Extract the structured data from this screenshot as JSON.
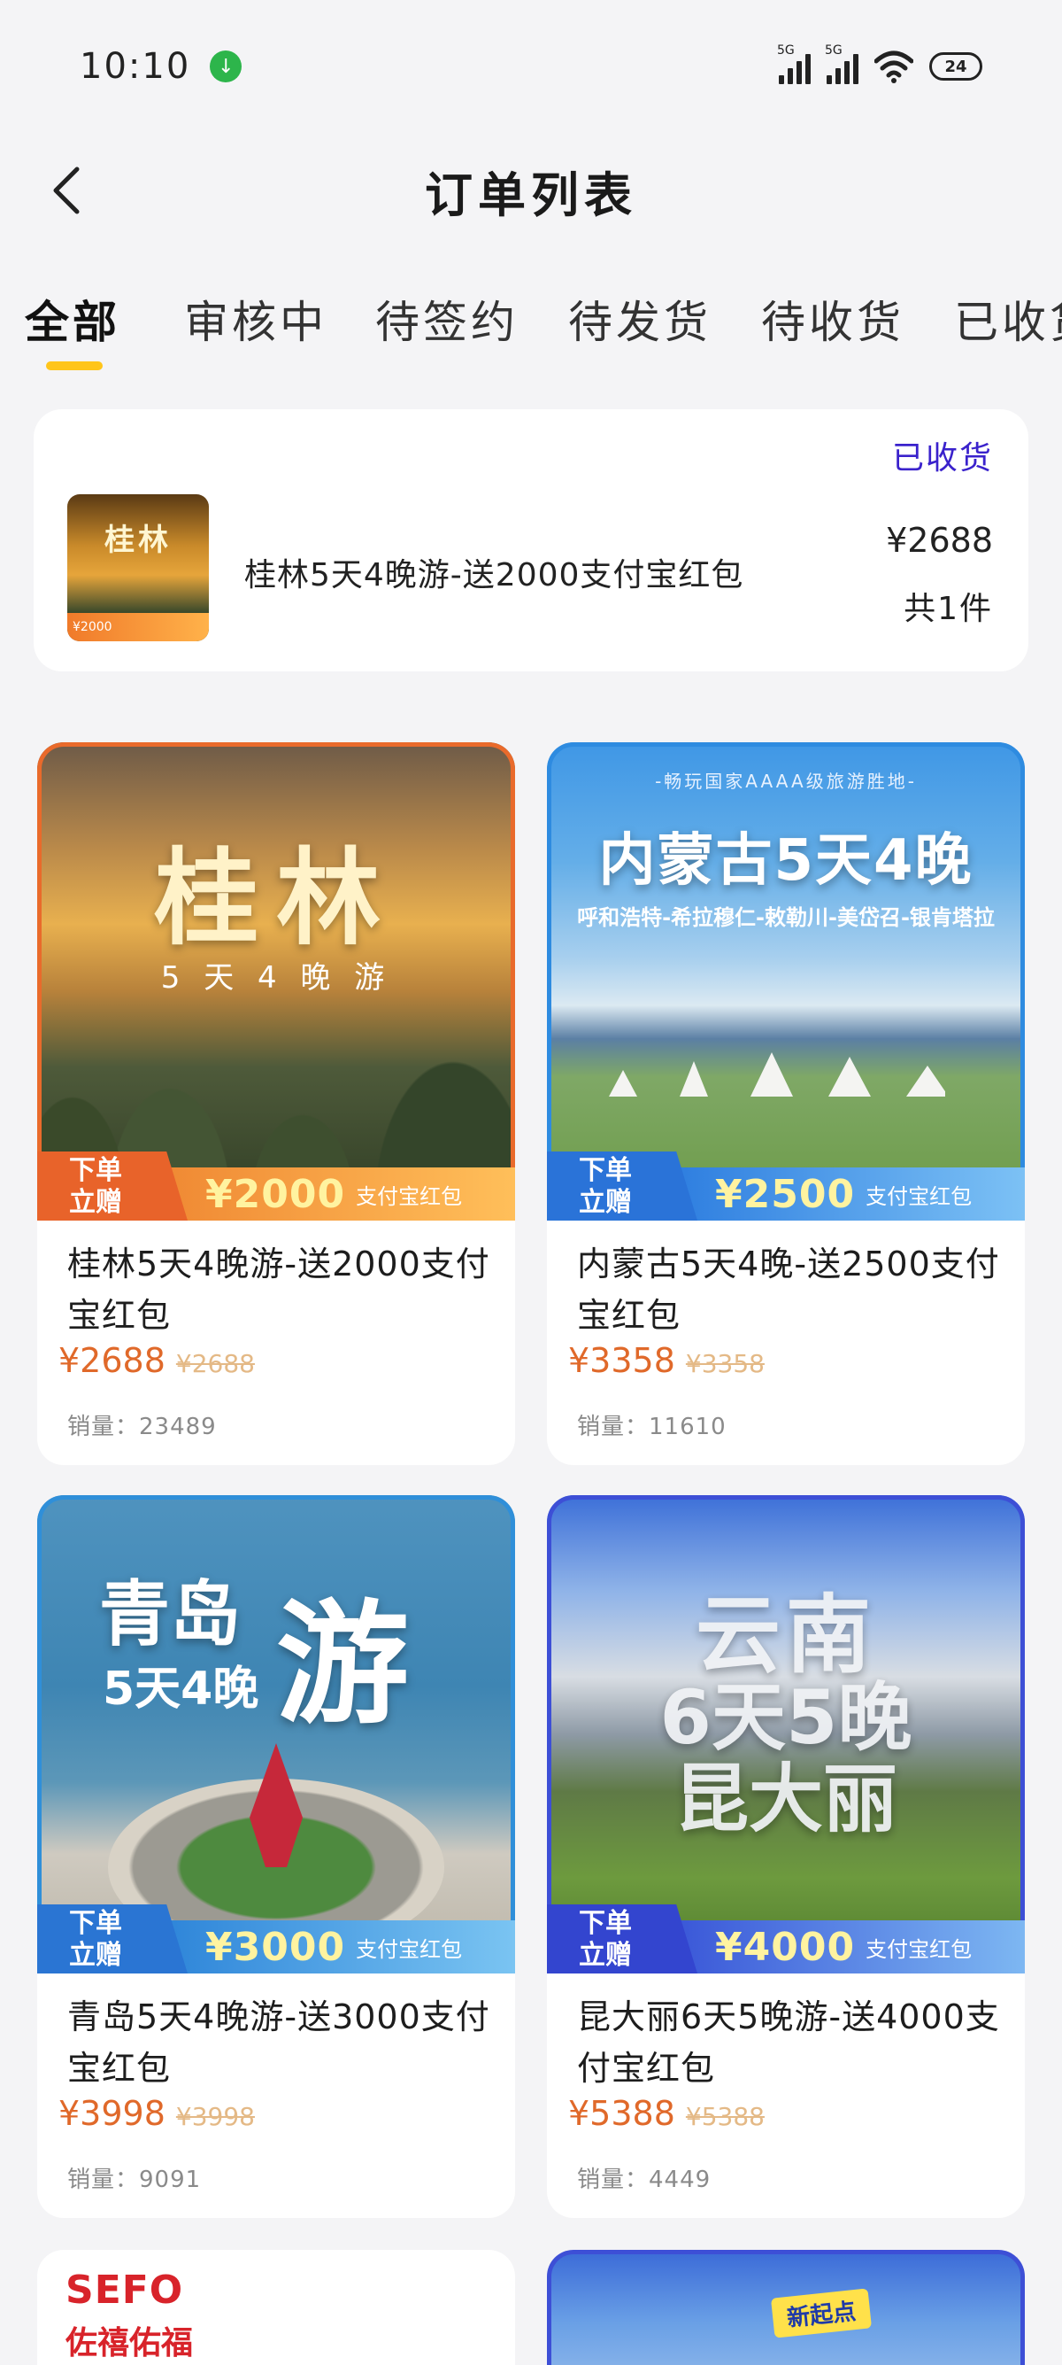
{
  "status_bar": {
    "time": "10:10",
    "signal_1_label": "5G",
    "signal_2_label": "5G",
    "battery": "24"
  },
  "header": {
    "title": "订单列表"
  },
  "tabs": [
    {
      "label": "全部",
      "active": true
    },
    {
      "label": "审核中"
    },
    {
      "label": "待签约"
    },
    {
      "label": "待发货"
    },
    {
      "label": "待收货"
    },
    {
      "label": "已收货"
    }
  ],
  "order": {
    "status": "已收货",
    "thumb_title": "桂林",
    "thumb_badge": "¥2000",
    "name": "桂林5天4晚游-送2000支付宝红包",
    "price": "¥2688",
    "quantity": "共1件"
  },
  "products": [
    {
      "image_title": "桂林",
      "image_subtitle": "5 天 4 晚 游",
      "promo_tag_line1": "下单",
      "promo_tag_line2": "立赠",
      "promo_amount": "¥2000",
      "promo_label": "支付宝红包",
      "name": "桂林5天4晚游-送2000支付宝红包",
      "price": "¥2688",
      "original_price": "¥2688",
      "sales": "销量：23489",
      "accent_color": "#e96a2b"
    },
    {
      "image_top_text": "-畅玩国家AAAA级旅游胜地-",
      "image_title": "内蒙古5天4晚",
      "image_subtitle": "呼和浩特-希拉穆仁-敕勒川-美岱召-银肯塔拉",
      "promo_tag_line1": "下单",
      "promo_tag_line2": "立赠",
      "promo_amount": "¥2500",
      "promo_label": "支付宝红包",
      "name": "内蒙古5天4晚-送2500支付宝红包",
      "price": "¥3358",
      "original_price": "¥3358",
      "sales": "销量：11610",
      "accent_color": "#2e8be0"
    },
    {
      "image_title": "青岛",
      "image_title_big": "游",
      "image_subtitle": "5天4晚",
      "promo_tag_line1": "下单",
      "promo_tag_line2": "立赠",
      "promo_amount": "¥3000",
      "promo_label": "支付宝红包",
      "name": "青岛5天4晚游-送3000支付宝红包",
      "price": "¥3998",
      "original_price": "¥3998",
      "sales": "销量：9091",
      "accent_color": "#2f8fd9"
    },
    {
      "image_title": "云南",
      "image_subtitle": "6天5晚",
      "image_subtitle2": "昆大丽",
      "promo_tag_line1": "下单",
      "promo_tag_line2": "立赠",
      "promo_amount": "¥4000",
      "promo_label": "支付宝红包",
      "name": "昆大丽6天5晚游-送4000支付宝红包",
      "price": "¥5388",
      "original_price": "¥5388",
      "sales": "销量：4449",
      "accent_color": "#3d4fd6"
    }
  ],
  "partial_products": [
    {
      "brand_line1": "SEFO",
      "brand_line2": "佐禧佑福"
    },
    {
      "badge": "新起点"
    }
  ]
}
